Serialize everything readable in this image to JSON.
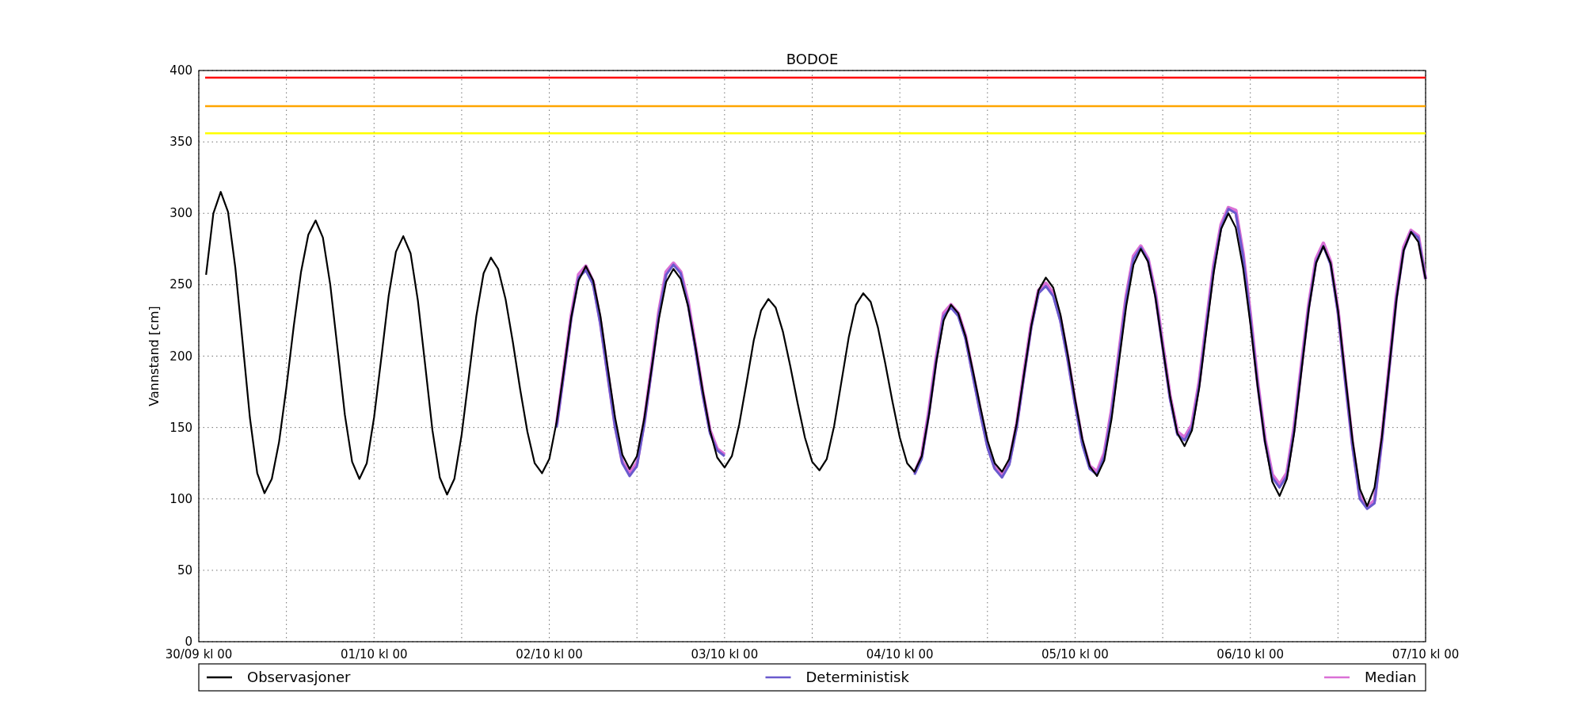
{
  "chart": {
    "chart_data": {
      "type": "line",
      "title": "BODOE",
      "ylabel": "Vannstand [cm]",
      "ylim": [
        0,
        400
      ],
      "yticks": [
        0,
        50,
        100,
        150,
        200,
        250,
        300,
        350,
        400
      ],
      "categories": [
        "30/09 kl 00",
        null,
        null,
        null,
        null,
        null,
        null,
        null,
        null,
        null,
        null,
        null,
        null,
        null,
        null,
        null,
        null,
        null,
        null,
        null,
        null,
        null,
        null,
        null,
        "01/10 kl 00",
        null,
        null,
        null,
        null,
        null,
        null,
        null,
        null,
        null,
        null,
        null,
        null,
        null,
        null,
        null,
        null,
        null,
        null,
        null,
        null,
        null,
        null,
        null,
        "02/10 kl 00",
        null,
        null,
        null,
        null,
        null,
        null,
        null,
        null,
        null,
        null,
        null,
        null,
        null,
        null,
        null,
        null,
        null,
        null,
        null,
        null,
        null,
        null,
        null,
        "03/10 kl 00",
        null,
        null,
        null,
        null,
        null,
        null,
        null,
        null,
        null,
        null,
        null,
        null,
        null,
        null,
        null,
        null,
        null,
        null,
        null,
        null,
        null,
        null,
        null,
        "04/10 kl 00",
        null,
        null,
        null,
        null,
        null,
        null,
        null,
        null,
        null,
        null,
        null,
        null,
        null,
        null,
        null,
        null,
        null,
        null,
        null,
        null,
        null,
        null,
        null,
        "05/10 kl 00",
        null,
        null,
        null,
        null,
        null,
        null,
        null,
        null,
        null,
        null,
        null,
        null,
        null,
        null,
        null,
        null,
        null,
        null,
        null,
        null,
        null,
        null,
        null,
        "06/10 kl 00",
        null,
        null,
        null,
        null,
        null,
        null,
        null,
        null,
        null,
        null,
        null,
        null,
        null,
        null,
        null,
        null,
        null,
        null,
        null,
        null,
        null,
        null,
        null,
        "07/10 kl 00"
      ],
      "series": [
        {
          "name": "Observasjoner",
          "color": "#000000",
          "values": [
            null,
            257,
            300,
            315,
            301,
            262,
            210,
            157,
            118,
            104,
            114,
            140,
            178,
            221,
            259,
            285,
            295,
            283,
            250,
            205,
            159,
            126,
            114,
            125,
            157,
            199,
            242,
            273,
            284,
            272,
            239,
            194,
            148,
            115,
            103,
            114,
            145,
            186,
            228,
            258,
            269,
            261,
            240,
            210,
            177,
            147,
            125,
            118,
            128,
            154,
            190,
            227,
            253,
            263,
            253,
            228,
            192,
            157,
            131,
            121,
            130,
            156,
            191,
            226,
            252,
            261,
            254,
            235,
            207,
            176,
            148,
            129,
            122,
            130,
            152,
            181,
            211,
            232,
            240,
            234,
            217,
            193,
            167,
            143,
            126,
            120,
            128,
            151,
            182,
            213,
            236,
            244,
            238,
            220,
            195,
            168,
            143,
            125,
            119,
            130,
            159,
            196,
            225,
            236,
            230,
            214,
            190,
            165,
            141,
            125,
            119,
            128,
            153,
            187,
            221,
            246,
            255,
            248,
            229,
            201,
            170,
            142,
            123,
            116,
            127,
            156,
            196,
            235,
            264,
            275,
            266,
            241,
            206,
            172,
            146,
            137,
            148,
            178,
            219,
            259,
            289,
            300,
            290,
            262,
            223,
            179,
            140,
            112,
            102,
            114,
            146,
            190,
            233,
            265,
            277,
            265,
            232,
            186,
            141,
            107,
            95,
            108,
            143,
            191,
            239,
            274,
            287,
            280,
            254
          ]
        },
        {
          "name": "Deterministisk",
          "color": "#6a5acd",
          "values": [
            null,
            null,
            null,
            null,
            null,
            null,
            null,
            null,
            null,
            null,
            null,
            null,
            null,
            null,
            null,
            null,
            null,
            null,
            null,
            null,
            null,
            null,
            null,
            null,
            null,
            null,
            null,
            null,
            null,
            null,
            null,
            null,
            null,
            null,
            null,
            null,
            null,
            null,
            null,
            null,
            null,
            null,
            null,
            null,
            null,
            null,
            null,
            null,
            null,
            150,
            188,
            226,
            255,
            260,
            250,
            222,
            186,
            150,
            125,
            116,
            123,
            152,
            190,
            229,
            257,
            264,
            258,
            236,
            205,
            173,
            146,
            134,
            130,
            null,
            null,
            null,
            null,
            null,
            null,
            null,
            null,
            null,
            null,
            null,
            null,
            null,
            null,
            null,
            null,
            null,
            null,
            null,
            null,
            null,
            null,
            null,
            null,
            null,
            117,
            128,
            160,
            197,
            228,
            234,
            228,
            212,
            186,
            160,
            136,
            121,
            115,
            124,
            150,
            186,
            220,
            244,
            249,
            242,
            224,
            197,
            166,
            138,
            121,
            117,
            130,
            160,
            200,
            240,
            268,
            276,
            267,
            242,
            206,
            170,
            145,
            141,
            150,
            180,
            222,
            262,
            290,
            303,
            300,
            270,
            227,
            180,
            140,
            115,
            108,
            116,
            148,
            192,
            234,
            266,
            277,
            264,
            230,
            182,
            136,
            100,
            93,
            97,
            140,
            190,
            240,
            274,
            287,
            283,
            254
          ]
        },
        {
          "name": "Median",
          "color": "#da70d6",
          "values": [
            null,
            null,
            null,
            null,
            null,
            null,
            null,
            null,
            null,
            null,
            null,
            null,
            null,
            null,
            null,
            null,
            null,
            null,
            null,
            null,
            null,
            null,
            null,
            null,
            null,
            null,
            null,
            null,
            null,
            null,
            null,
            null,
            null,
            null,
            null,
            null,
            null,
            null,
            null,
            null,
            null,
            null,
            null,
            null,
            null,
            null,
            null,
            null,
            null,
            152,
            190,
            228,
            257,
            263,
            252,
            224,
            188,
            152,
            126,
            118,
            125,
            154,
            192,
            231,
            259,
            265,
            259,
            238,
            207,
            175,
            148,
            135,
            131,
            null,
            null,
            null,
            null,
            null,
            null,
            null,
            null,
            null,
            null,
            null,
            null,
            null,
            null,
            null,
            null,
            null,
            null,
            null,
            null,
            null,
            null,
            null,
            null,
            null,
            118,
            130,
            162,
            199,
            230,
            236,
            230,
            214,
            188,
            162,
            138,
            122,
            117,
            126,
            152,
            188,
            222,
            246,
            251,
            244,
            226,
            199,
            168,
            140,
            123,
            119,
            132,
            162,
            202,
            242,
            270,
            277,
            268,
            244,
            208,
            172,
            147,
            143,
            152,
            182,
            224,
            264,
            292,
            304,
            302,
            272,
            229,
            182,
            142,
            117,
            110,
            118,
            150,
            194,
            236,
            268,
            279,
            266,
            232,
            184,
            138,
            102,
            94,
            99,
            142,
            192,
            242,
            276,
            288,
            284,
            254
          ]
        }
      ],
      "grid": true,
      "legend": "bottom",
      "ref_lines": [
        {
          "axis": "y",
          "value": 395,
          "color": "#ff0000"
        },
        {
          "axis": "y",
          "value": 375,
          "color": "#ffa500"
        },
        {
          "axis": "y",
          "value": 356,
          "color": "#ffff00"
        }
      ]
    }
  }
}
